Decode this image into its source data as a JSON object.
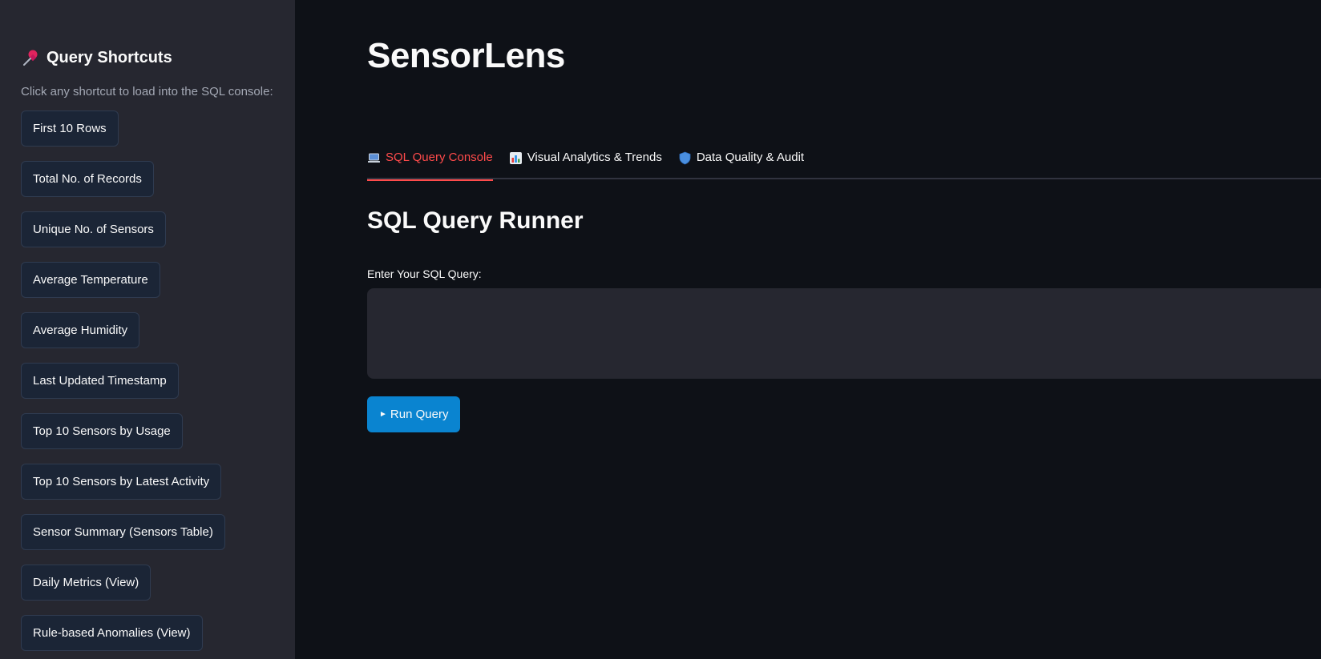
{
  "sidebar": {
    "title": "Query Shortcuts",
    "hint": "Click any shortcut to load into the SQL console:",
    "shortcuts": [
      "First 10 Rows",
      "Total No. of Records",
      "Unique No. of Sensors",
      "Average Temperature",
      "Average Humidity",
      "Last Updated Timestamp",
      "Top 10 Sensors by Usage",
      "Top 10 Sensors by Latest Activity",
      "Sensor Summary (Sensors Table)",
      "Daily Metrics (View)",
      "Rule-based Anomalies (View)"
    ],
    "title_icon": "pushpin-icon"
  },
  "main": {
    "app_title": "SensorLens",
    "tabs": [
      {
        "label": "SQL Query Console",
        "icon": "laptop-icon",
        "active": true
      },
      {
        "label": "Visual Analytics & Trends",
        "icon": "bar-chart-icon",
        "active": false
      },
      {
        "label": "Data Quality & Audit",
        "icon": "shield-icon",
        "active": false
      }
    ],
    "section_title": "SQL Query Runner",
    "input_label": "Enter Your SQL Query:",
    "sql_value": "",
    "run_button": "Run Query"
  },
  "colors": {
    "accent_active_tab": "#ff4b4b",
    "run_button": "#0a84d0",
    "sidebar_bg": "#262730",
    "main_bg": "#0e1117"
  }
}
